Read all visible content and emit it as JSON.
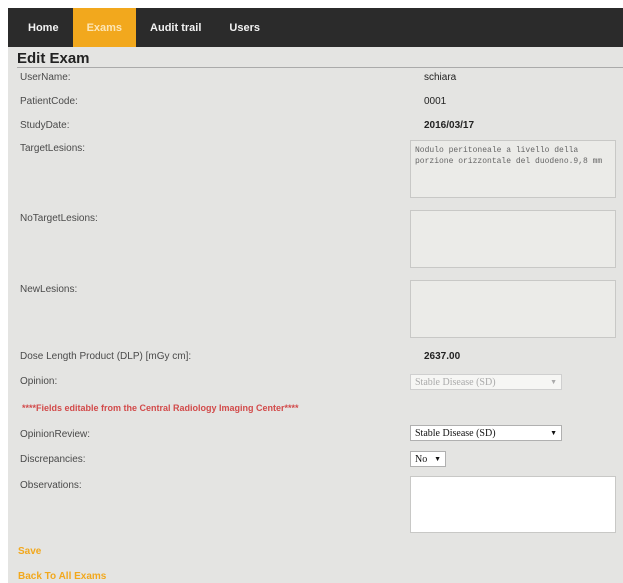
{
  "nav": {
    "items": [
      "Home",
      "Exams",
      "Audit trail",
      "Users"
    ],
    "active_index": 1
  },
  "page_title": "Edit Exam",
  "fields": {
    "username": {
      "label": "UserName:",
      "value": "schiara"
    },
    "patient_code": {
      "label": "PatientCode:",
      "value": "0001"
    },
    "study_date": {
      "label": "StudyDate:",
      "value": "2016/03/17"
    },
    "target_lesions": {
      "label": "TargetLesions:",
      "value": "Nodulo peritoneale a livello della porzione orizzontale del duodeno.9,8 mm"
    },
    "no_target_lesions": {
      "label": "NoTargetLesions:",
      "value": ""
    },
    "new_lesions": {
      "label": "NewLesions:",
      "value": ""
    },
    "dlp": {
      "label": "Dose Length Product (DLP) [mGy cm]:",
      "value": "2637.00"
    },
    "opinion": {
      "label": "Opinion:",
      "value": "Stable Disease (SD)"
    },
    "opinion_review": {
      "label": "OpinionReview:",
      "value": "Stable Disease (SD)"
    },
    "discrepancies": {
      "label": "Discrepancies:",
      "value": "No"
    },
    "observations": {
      "label": "Observations:",
      "value": ""
    }
  },
  "warning": "****Fields editable from the Central Radiology Imaging Center****",
  "links": {
    "save": "Save",
    "back": "Back To All Exams"
  },
  "colors": {
    "accent": "#f2a81d",
    "nav_bg": "#2b2b2b",
    "warning": "#d24a4a"
  }
}
